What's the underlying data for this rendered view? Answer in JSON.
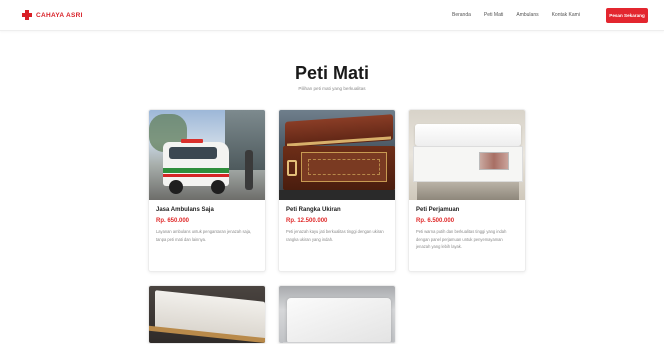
{
  "navbar": {
    "brand": "CAHAYA ASRI",
    "links": [
      {
        "label": "Beranda"
      },
      {
        "label": "Peti Mati"
      },
      {
        "label": "Ambulans"
      },
      {
        "label": "Kontak Kami"
      }
    ],
    "cta_label": "Pesan Sekarang",
    "accent_color": "#e3262f"
  },
  "main": {
    "title": "Peti Mati",
    "subtitle": "Pilihan peti mati yang berkualitas"
  },
  "products": [
    {
      "title": "Jasa Ambulans Saja",
      "price": "Rp. 650.000",
      "desc": "Layanan ambulans untuk pengantaran jenazah saja, tanpa peti mati dan lainnya.",
      "image": "ambulance-image"
    },
    {
      "title": "Peti Rangka Ukiran",
      "price": "Rp. 12.500.000",
      "desc": "Peti jenazah kayu jati berkualitas tinggi dengan ukiran rangka ukiran yang indah.",
      "image": "wooden-coffin-image"
    },
    {
      "title": "Peti Perjamuan",
      "price": "Rp. 6.500.000",
      "desc": "Peti warna putih dan berkualitas tinggi yang indah dengan panel perjamuan untuk penyemayaman jenazah yang lebih layak.",
      "image": "white-coffin-image"
    },
    {
      "title": "",
      "price": "",
      "desc": "",
      "image": "dark-coffin-image"
    },
    {
      "title": "",
      "price": "",
      "desc": "",
      "image": "grey-coffin-image"
    }
  ]
}
